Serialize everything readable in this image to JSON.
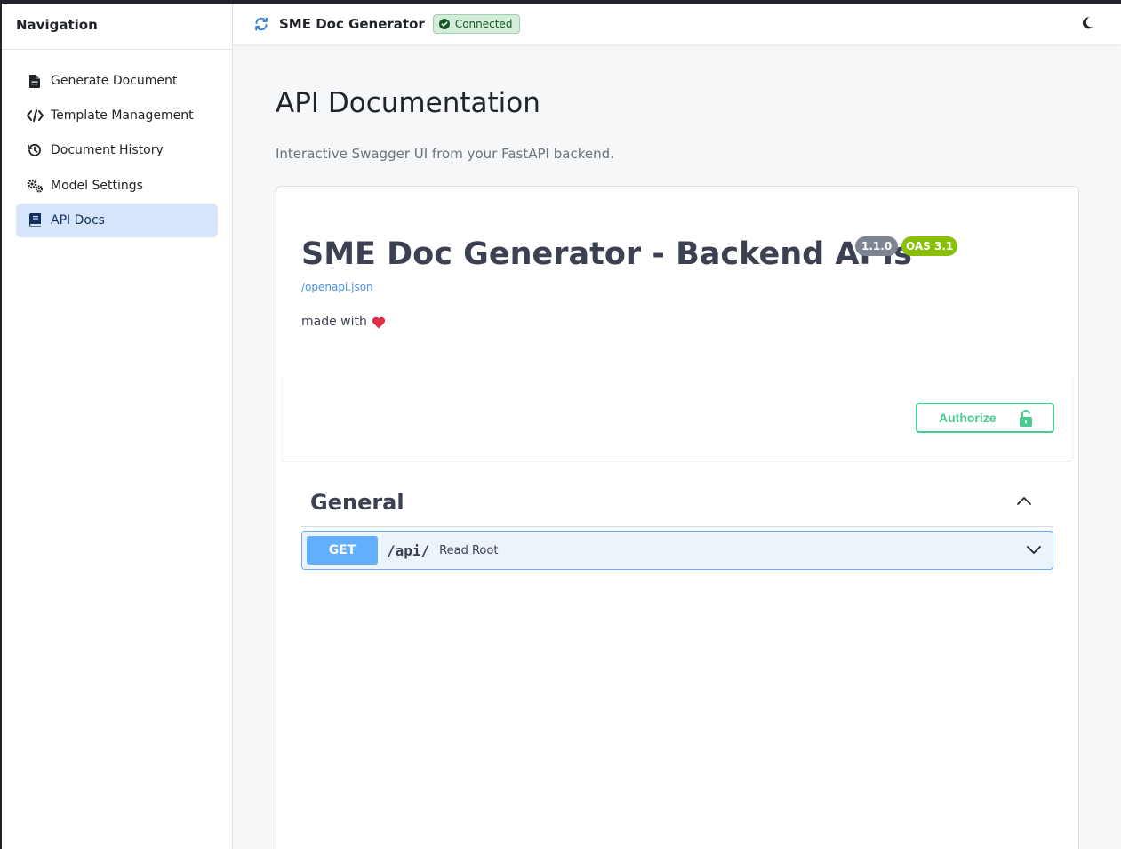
{
  "sidebar": {
    "title": "Navigation",
    "items": [
      {
        "label": "Generate Document",
        "icon": "file-text-icon"
      },
      {
        "label": "Template Management",
        "icon": "code-icon"
      },
      {
        "label": "Document History",
        "icon": "history-icon"
      },
      {
        "label": "Model Settings",
        "icon": "gears-icon"
      },
      {
        "label": "API Docs",
        "icon": "book-icon",
        "active": true
      }
    ]
  },
  "topbar": {
    "app_title": "SME Doc Generator",
    "status": "Connected",
    "status_color": "#155724"
  },
  "main": {
    "title": "API Documentation",
    "subtitle": "Interactive Swagger UI from your FastAPI backend."
  },
  "swagger": {
    "api_title": "SME Doc Generator - Backend APIs",
    "version": "1.1.0",
    "oas_version": "OAS 3.1",
    "spec_link": "/openapi.json",
    "made_with": "made with",
    "authorize_label": "Authorize",
    "tag": "General",
    "operations": [
      {
        "method": "GET",
        "path": "/api/",
        "summary": "Read Root"
      }
    ]
  },
  "colors": {
    "accent": "#d6e5fb",
    "get_method": "#61affe",
    "authorize": "#49cc90",
    "oas_badge": "#89bf04"
  }
}
